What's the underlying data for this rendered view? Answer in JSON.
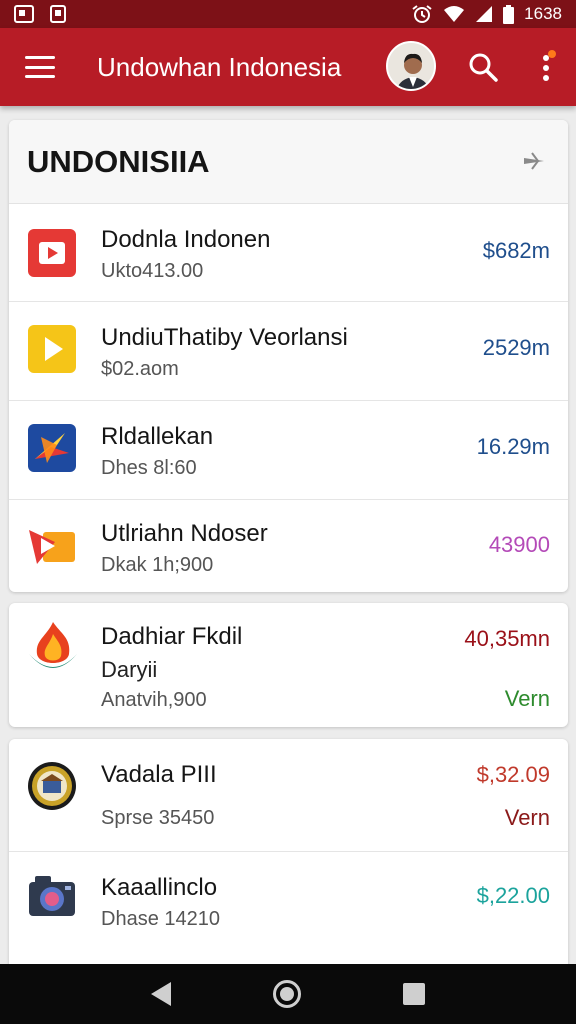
{
  "status_bar": {
    "time": "1638",
    "icons": [
      "gallery-icon",
      "notification-icon",
      "alarm-icon",
      "wifi-icon",
      "signal-icon",
      "battery-icon"
    ]
  },
  "app_bar": {
    "title": "Undowhan Indonesia",
    "icons": [
      "menu-icon",
      "avatar",
      "search-icon",
      "more-vert-icon"
    ]
  },
  "card1": {
    "title": "UNDONISIIA",
    "items": [
      {
        "title": "Dodnla Indonen",
        "subtitle": "Ukto413.00",
        "value": "$682m",
        "value_color": "#1f4e8c",
        "icon": "youtube-icon"
      },
      {
        "title": "UndiuThatiby Veorlansi",
        "subtitle": "$02.aom",
        "value": "2529m",
        "value_color": "#1f4e8c",
        "icon": "play-icon"
      },
      {
        "title": "Rldallekan",
        "subtitle": "Dhes 8l:60",
        "value": "16.29m",
        "value_color": "#1f4e8c",
        "icon": "star-icon"
      },
      {
        "title": "Utlriahn Ndoser",
        "subtitle": "Dkak 1h;900",
        "value": "43900",
        "value_color": "#b44ab8",
        "icon": "slides-icon"
      }
    ]
  },
  "card2": {
    "title": "Dadhiar Fkdil",
    "line2": "Daryii",
    "subtitle": "Anatvih,900",
    "value": "40,35mn",
    "value_color": "#9a1018",
    "tag": "Vern",
    "tag_color": "#2e8b2e",
    "icon": "flame-emblem-icon"
  },
  "card3": {
    "items": [
      {
        "title": "Vadala PIII",
        "subtitle": "Sprse 35450",
        "value": "$,32.09",
        "value_color": "#c0392b",
        "tag": "Vern",
        "tag_color": "#8b1a1a",
        "icon": "seal-icon"
      },
      {
        "title": "Kaaallinclo",
        "subtitle": "Dhase 14210",
        "value": "$,22.00",
        "value_color": "#1ba39c",
        "icon": "camera-icon"
      }
    ]
  }
}
